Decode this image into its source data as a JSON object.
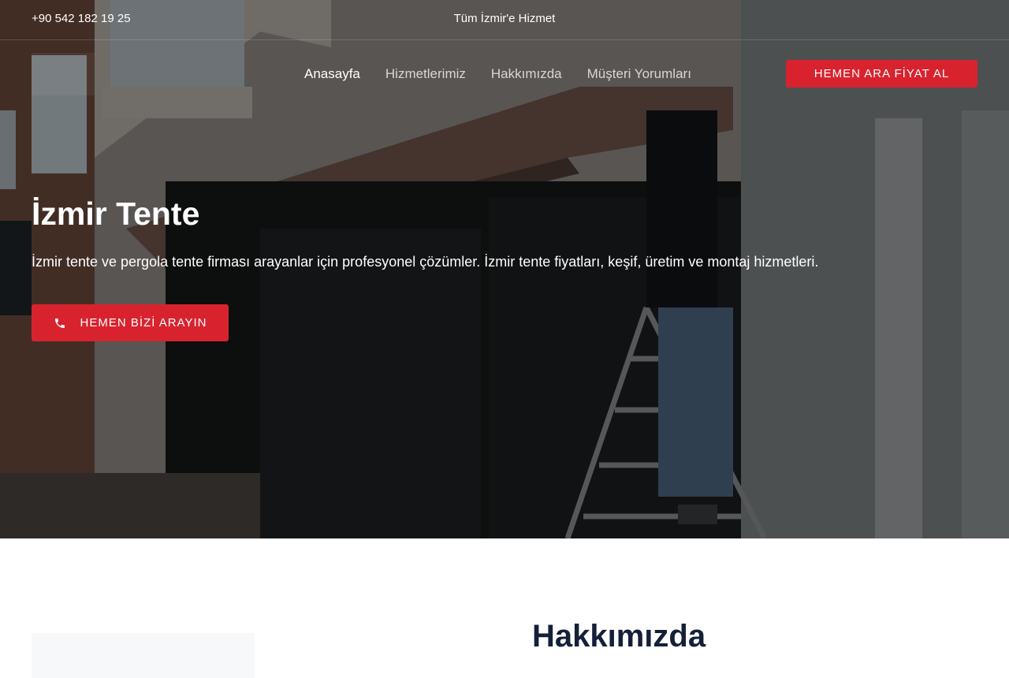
{
  "topbar": {
    "phone": "+90 542 182 19 25",
    "service_area": "Tüm İzmir'e Hizmet"
  },
  "nav": {
    "items": [
      {
        "label": "Anasayfa",
        "active": true
      },
      {
        "label": "Hizmetlerimiz",
        "active": false
      },
      {
        "label": "Hakkımızda",
        "active": false
      },
      {
        "label": "Müşteri Yorumları",
        "active": false
      }
    ],
    "cta_label": "HEMEN ARA FİYAT AL"
  },
  "hero": {
    "title": "İzmir Tente",
    "subtitle": "İzmir tente ve pergola tente firması arayanlar için profesyonel çözümler. İzmir tente fiyatları, keşif, üretim ve montaj hizmetleri.",
    "cta_label": "HEMEN BİZİ ARAYIN",
    "cta_icon": "phone-icon",
    "background": "awning-installation-photo"
  },
  "about": {
    "title": "Hakkımızda"
  },
  "colors": {
    "accent": "#d8232f",
    "heading_dark": "#152038"
  }
}
